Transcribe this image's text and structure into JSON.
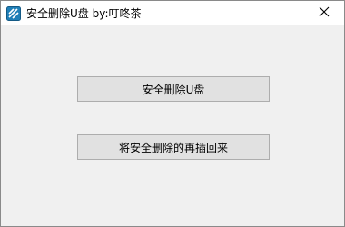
{
  "window": {
    "title": "安全删除U盘 by:叮咚茶",
    "app_icon": "usb-drive-icon",
    "close_icon": "close-icon"
  },
  "buttons": {
    "safe_remove_label": "安全删除U盘",
    "reinsert_label": "将安全删除的再插回来"
  },
  "colors": {
    "titlebar_bg": "#ffffff",
    "client_bg": "#f0f0f0",
    "button_bg": "#e1e1e1",
    "button_border": "#adadad",
    "icon_accent": "#1e7fb8"
  }
}
